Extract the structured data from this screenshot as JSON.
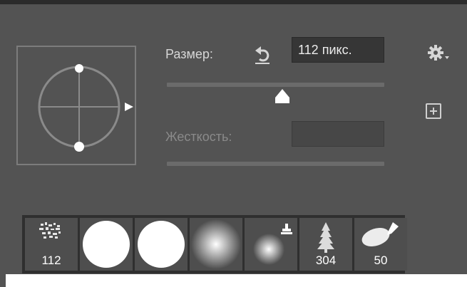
{
  "brush": {
    "size_label": "Размер:",
    "size_value": "112 пикс.",
    "size_slider_fraction": 0.53,
    "hardness_label": "Жесткость:",
    "hardness_value": ""
  },
  "icons": {
    "reset": "reset-icon",
    "settings": "gear-icon",
    "new_preset": "add-preset-icon",
    "preview_arrow": "triangle-right-icon"
  },
  "presets": [
    {
      "kind": "texture",
      "label": "112"
    },
    {
      "kind": "hard-round",
      "label": ""
    },
    {
      "kind": "hard-round",
      "label": ""
    },
    {
      "kind": "soft-round",
      "label": ""
    },
    {
      "kind": "soft-round-stamp",
      "label": ""
    },
    {
      "kind": "tree",
      "label": "304"
    },
    {
      "kind": "leaf-pen",
      "label": "50"
    }
  ],
  "colors": {
    "panel": "#535353",
    "field": "#363636",
    "text": "#d6d6d6",
    "disabled_text": "#8a8a8a"
  }
}
